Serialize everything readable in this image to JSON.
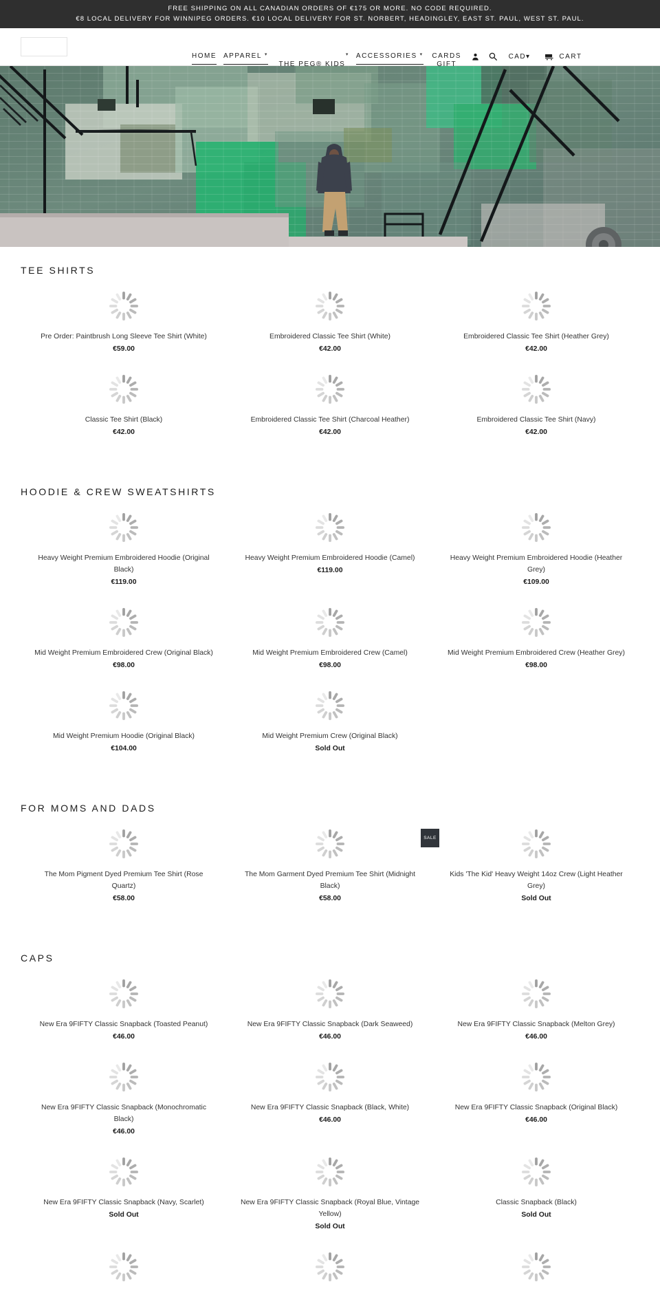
{
  "announcement": {
    "line1": "FREE SHIPPING ON ALL CANADIAN ORDERS OF €175 OR MORE. NO CODE REQUIRED.",
    "line2": "€8 LOCAL DELIVERY FOR WINNIPEG ORDERS. €10 LOCAL DELIVERY FOR ST. NORBERT, HEADINGLEY, EAST ST. PAUL, WEST ST. PAUL."
  },
  "header": {
    "nav": {
      "home": "HOME",
      "apparel": "APPAREL",
      "the_peg_kids": "THE PEG® KIDS",
      "accessories": "ACCESSORIES",
      "gift_cards_line1": "GIFT",
      "gift_cards_line2": "CARDS",
      "caret": "▾"
    },
    "currency": "CAD",
    "cart_label": "CART"
  },
  "sections": [
    {
      "title": "TEE SHIRTS",
      "products": [
        {
          "title": "Pre Order: Paintbrush Long Sleeve Tee Shirt (White)",
          "price": "€59.00",
          "sale": false
        },
        {
          "title": "Embroidered Classic Tee Shirt (White)",
          "price": "€42.00",
          "sale": false
        },
        {
          "title": "Embroidered Classic Tee Shirt (Heather Grey)",
          "price": "€42.00",
          "sale": false
        },
        {
          "title": "Classic Tee Shirt (Black)",
          "price": "€42.00",
          "sale": false
        },
        {
          "title": "Embroidered Classic Tee Shirt (Charcoal Heather)",
          "price": "€42.00",
          "sale": false
        },
        {
          "title": "Embroidered Classic Tee Shirt (Navy)",
          "price": "€42.00",
          "sale": false
        }
      ]
    },
    {
      "title": "HOODIE & CREW SWEATSHIRTS",
      "products": [
        {
          "title": "Heavy Weight Premium Embroidered Hoodie (Original Black)",
          "price": "€119.00",
          "sale": false
        },
        {
          "title": "Heavy Weight Premium Embroidered Hoodie (Camel)",
          "price": "€119.00",
          "sale": false
        },
        {
          "title": "Heavy Weight Premium Embroidered Hoodie (Heather Grey)",
          "price": "€109.00",
          "sale": false
        },
        {
          "title": "Mid Weight Premium Embroidered Crew (Original Black)",
          "price": "€98.00",
          "sale": false
        },
        {
          "title": "Mid Weight Premium Embroidered Crew (Camel)",
          "price": "€98.00",
          "sale": false
        },
        {
          "title": "Mid Weight Premium Embroidered Crew (Heather Grey)",
          "price": "€98.00",
          "sale": false
        },
        {
          "title": "Mid Weight Premium Hoodie (Original Black)",
          "price": "€104.00",
          "sale": false
        },
        {
          "title": "Mid Weight Premium Crew (Original Black)",
          "price": "Sold Out",
          "sale": false
        }
      ]
    },
    {
      "title": "FOR MOMS AND DADS",
      "products": [
        {
          "title": "The Mom Pigment Dyed Premium Tee Shirt (Rose Quartz)",
          "price": "€58.00",
          "sale": false
        },
        {
          "title": "The Mom Garment Dyed Premium Tee Shirt (Midnight Black)",
          "price": "€58.00",
          "sale": false
        },
        {
          "title": "Kids 'The Kid' Heavy Weight 14oz Crew (Light Heather Grey)",
          "price": "Sold Out",
          "sale": true,
          "sale_label": "SALE"
        }
      ]
    },
    {
      "title": "CAPS",
      "products": [
        {
          "title": "New Era 9FIFTY Classic Snapback (Toasted Peanut)",
          "price": "€46.00",
          "sale": false
        },
        {
          "title": "New Era 9FIFTY Classic Snapback (Dark Seaweed)",
          "price": "€46.00",
          "sale": false
        },
        {
          "title": "New Era 9FIFTY Classic Snapback (Melton Grey)",
          "price": "€46.00",
          "sale": false
        },
        {
          "title": "New Era 9FIFTY Classic Snapback (Monochromatic Black)",
          "price": "€46.00",
          "sale": false
        },
        {
          "title": "New Era 9FIFTY Classic Snapback (Black, White)",
          "price": "€46.00",
          "sale": false
        },
        {
          "title": "New Era 9FIFTY Classic Snapback (Original Black)",
          "price": "€46.00",
          "sale": false
        },
        {
          "title": "New Era 9FIFTY Classic Snapback (Navy, Scarlet)",
          "price": "Sold Out",
          "sale": false
        },
        {
          "title": "New Era 9FIFTY Classic Snapback (Royal Blue, Vintage Yellow)",
          "price": "Sold Out",
          "sale": false
        },
        {
          "title": "Classic Snapback (Black)",
          "price": "Sold Out",
          "sale": false
        },
        {
          "title": "",
          "price": "",
          "sale": false
        },
        {
          "title": "",
          "price": "",
          "sale": false
        },
        {
          "title": "",
          "price": "",
          "sale": false
        }
      ]
    }
  ],
  "colors": {
    "announcement_bg": "#2f2f2f",
    "text": "#1c1c1c",
    "product_title": "#333333",
    "sale_badge_bg": "#30343a",
    "hero_green": "#2fae6e"
  }
}
